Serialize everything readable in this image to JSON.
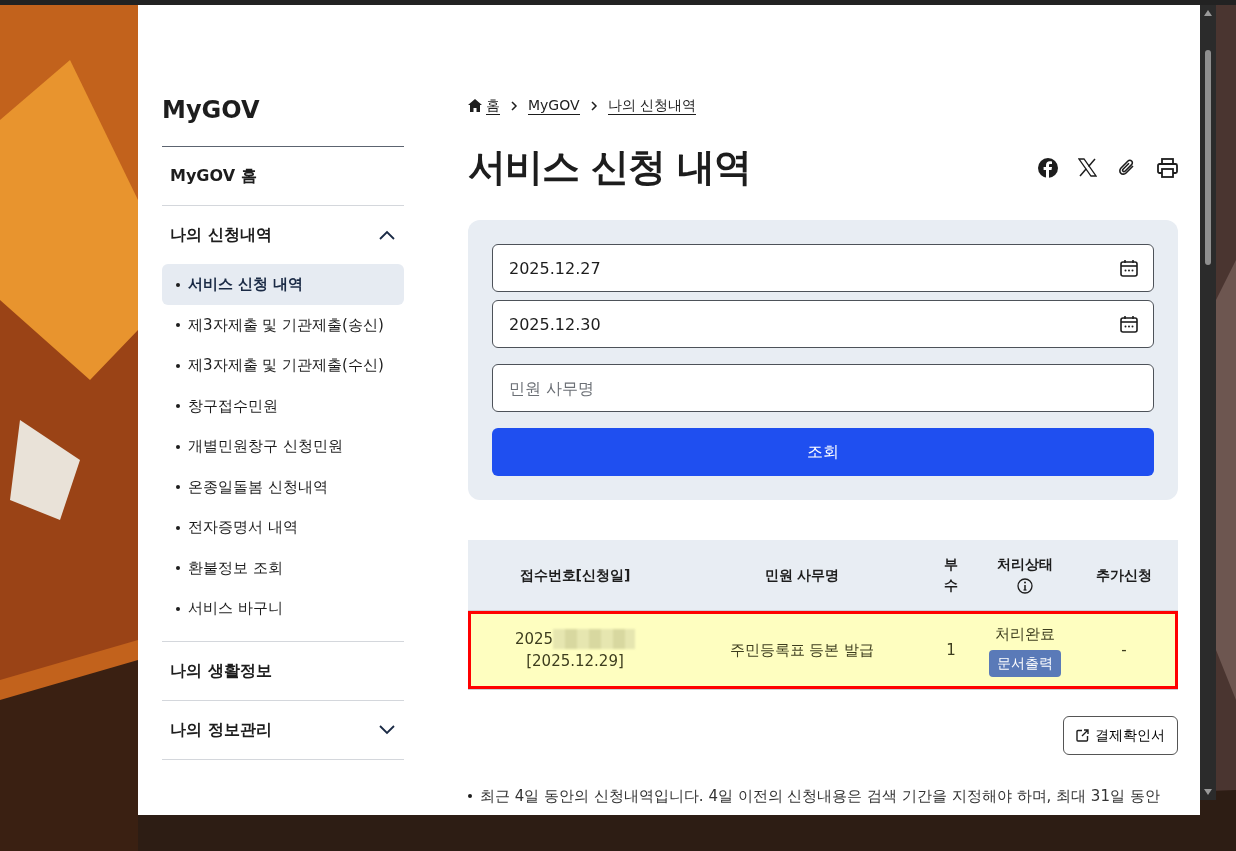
{
  "sidebar": {
    "title": "MyGOV",
    "items": [
      {
        "kind": "link",
        "label": "MyGOV 홈"
      },
      {
        "kind": "group",
        "label": "나의 신청내역",
        "expanded": true,
        "children": [
          {
            "label": "서비스 신청 내역",
            "selected": true
          },
          {
            "label": "제3자제출 및 기관제출(송신)",
            "selected": false
          },
          {
            "label": "제3자제출 및 기관제출(수신)",
            "selected": false
          },
          {
            "label": "창구접수민원",
            "selected": false
          },
          {
            "label": "개별민원창구 신청민원",
            "selected": false
          },
          {
            "label": "온종일돌봄 신청내역",
            "selected": false
          },
          {
            "label": "전자증명서 내역",
            "selected": false
          },
          {
            "label": "환불정보 조회",
            "selected": false
          },
          {
            "label": "서비스 바구니",
            "selected": false
          }
        ]
      },
      {
        "kind": "link",
        "label": "나의 생활정보"
      },
      {
        "kind": "group",
        "label": "나의 정보관리",
        "expanded": false
      }
    ]
  },
  "breadcrumb": [
    "홈",
    "MyGOV",
    "나의 신청내역"
  ],
  "page_title": "서비스 신청 내역",
  "search": {
    "date_from": "2025.12.27",
    "date_to": "2025.12.30",
    "placeholder": "민원 사무명",
    "button": "조회"
  },
  "table": {
    "columns": [
      "접수번호[신청일]",
      "민원 사무명",
      "부수",
      "처리상태",
      "추가신청"
    ],
    "rows": [
      {
        "receipt_no": "2025",
        "date": "[2025.12.29]",
        "name": "주민등록표 등본 발급",
        "copies": "1",
        "status": "처리완료",
        "action": "문서출력",
        "extra": "-",
        "highlighted": true
      }
    ]
  },
  "receipt_button": "결제확인서",
  "note": "최근 4일 동안의 신청내역입니다. 4일 이전의 신청내용은 검색 기간을 지정해야 하며, 최대 31일 동안"
}
